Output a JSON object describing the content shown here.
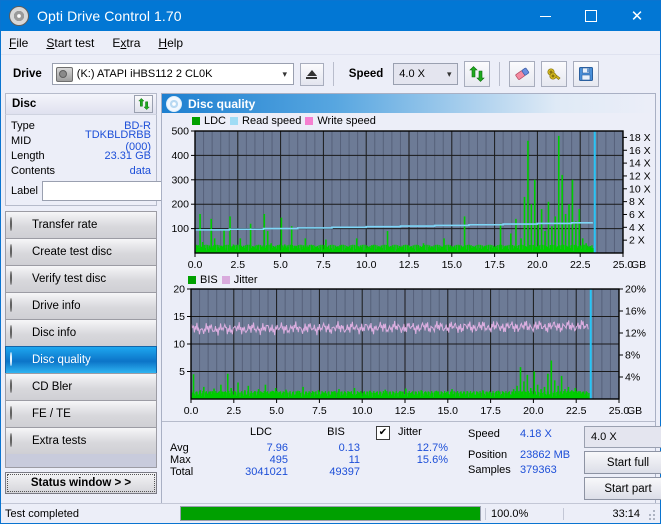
{
  "window": {
    "title": "Opti Drive Control 1.70",
    "icon": "disc-icon",
    "minimize": "–",
    "maximize": "□",
    "close": "✕"
  },
  "menubar": {
    "items": [
      {
        "label": "File",
        "accel": "F"
      },
      {
        "label": "Start test",
        "accel": "S"
      },
      {
        "label": "Extra",
        "accel": "x"
      },
      {
        "label": "Help",
        "accel": "H"
      }
    ]
  },
  "toolbar": {
    "drive_label": "Drive",
    "drive_value": "(K:)  ATAPI iHBS112  2 CL0K",
    "eject_title": "eject-button",
    "speed_label": "Speed",
    "speed_value": "4.0 X",
    "refresh_icon": "refresh-icon",
    "eraser_icon": "eraser-icon",
    "keys_icon": "keys-icon",
    "save_icon": "save-icon"
  },
  "sidebar": {
    "disc_panel": {
      "title": "Disc",
      "refresh_icon": "refresh-icon",
      "rows": [
        {
          "key": "Type",
          "value": "BD-R"
        },
        {
          "key": "MID",
          "value": "TDKBLDRBB (000)"
        },
        {
          "key": "Length",
          "value": "23.31 GB"
        },
        {
          "key": "Contents",
          "value": "data"
        }
      ],
      "label_key": "Label",
      "label_value": "",
      "label_placeholder": "",
      "label_button_icon": "cd-icon"
    },
    "nav": [
      {
        "label": "Transfer rate",
        "active": false
      },
      {
        "label": "Create test disc",
        "active": false
      },
      {
        "label": "Verify test disc",
        "active": false
      },
      {
        "label": "Drive info",
        "active": false
      },
      {
        "label": "Disc info",
        "active": false
      },
      {
        "label": "Disc quality",
        "active": true
      },
      {
        "label": "CD Bler",
        "active": false
      },
      {
        "label": "FE / TE",
        "active": false
      },
      {
        "label": "Extra tests",
        "active": false
      }
    ],
    "status_window_button": "Status window > >"
  },
  "main": {
    "header_title": "Disc quality",
    "header_icon": "disc-quality-icon"
  },
  "stats": {
    "col_headers": [
      "",
      "LDC",
      "BIS",
      "",
      "Jitter"
    ],
    "jitter_checked": true,
    "jitter_check_glyph": "✔",
    "rows": [
      {
        "key": "Avg",
        "ldc": "7.96",
        "bis": "0.13",
        "jitter": "12.7%"
      },
      {
        "key": "Max",
        "ldc": "495",
        "bis": "11",
        "jitter": "15.6%"
      },
      {
        "key": "Total",
        "ldc": "3041021",
        "bis": "49397",
        "jitter": ""
      }
    ]
  },
  "test_panel": {
    "speed_key": "Speed",
    "speed_value": "4.18 X",
    "position_key": "Position",
    "position_value": "23862 MB",
    "samples_key": "Samples",
    "samples_value": "379363",
    "speed_select": "4.0 X",
    "start_full": "Start full",
    "start_part": "Start part"
  },
  "statusbar": {
    "text": "Test completed",
    "percent": "100.0%",
    "progress": 100,
    "time": "33:14",
    "progress_color": "#00a000"
  },
  "chart_data": [
    {
      "type": "line",
      "name": "ldc-chart",
      "title": "",
      "xlabel": "GB",
      "ylabel": "",
      "x_ticks": [
        "0.0",
        "2.5",
        "5.0",
        "7.5",
        "10.0",
        "12.5",
        "15.0",
        "17.5",
        "20.0",
        "22.5",
        "25.0"
      ],
      "xlim": [
        0,
        25
      ],
      "y_left_ticks": [
        "100",
        "200",
        "300",
        "400",
        "500"
      ],
      "ylim": [
        0,
        500
      ],
      "y_right_ticks": [
        "2 X",
        "4 X",
        "6 X",
        "8 X",
        "10 X",
        "12 X",
        "14 X",
        "16 X",
        "18 X"
      ],
      "y_right_lim": [
        0,
        19
      ],
      "grid": true,
      "legend": [
        {
          "label": "LDC",
          "color": "#00a000"
        },
        {
          "label": "Read speed",
          "color": "#9fdcf5"
        },
        {
          "label": "Write speed",
          "color": "#f57fd0"
        }
      ],
      "series": [
        {
          "name": "LDC",
          "type": "impulse",
          "color": "#00cc00",
          "x": [
            0.1,
            0.25,
            0.4,
            0.55,
            0.7,
            0.9,
            1.1,
            1.3,
            1.5,
            1.65,
            1.8,
            2.0,
            2.2,
            2.4,
            2.6,
            2.8,
            3.0,
            3.2,
            3.4,
            3.6,
            3.8,
            4.0,
            4.2,
            4.4,
            4.6,
            4.8,
            5.0,
            5.2,
            5.4,
            5.6,
            5.8,
            6.0,
            6.2,
            6.4,
            6.6,
            6.8,
            7.0,
            7.3,
            7.6,
            7.9,
            8.2,
            8.5,
            8.8,
            9.1,
            9.4,
            9.7,
            10.0,
            10.3,
            10.6,
            10.9,
            11.2,
            11.5,
            11.8,
            12.1,
            12.4,
            12.7,
            13.0,
            13.3,
            13.6,
            13.9,
            14.2,
            14.5,
            14.8,
            15.1,
            15.4,
            15.7,
            16.0,
            16.3,
            16.6,
            16.9,
            17.2,
            17.5,
            17.8,
            18.1,
            18.4,
            18.7,
            19.0,
            19.2,
            19.4,
            19.6,
            19.8,
            20.0,
            20.2,
            20.4,
            20.6,
            20.8,
            21.0,
            21.2,
            21.4,
            21.6,
            21.8,
            22.0,
            22.2,
            22.4,
            22.6,
            22.8,
            23.0,
            23.2
          ],
          "y": [
            30,
            160,
            45,
            20,
            25,
            140,
            60,
            25,
            30,
            95,
            20,
            150,
            35,
            25,
            60,
            30,
            25,
            120,
            20,
            30,
            25,
            160,
            90,
            40,
            25,
            30,
            145,
            35,
            25,
            110,
            30,
            20,
            25,
            60,
            25,
            30,
            20,
            25,
            55,
            20,
            25,
            30,
            20,
            25,
            60,
            25,
            20,
            30,
            25,
            20,
            90,
            25,
            20,
            25,
            30,
            20,
            25,
            40,
            25,
            20,
            25,
            60,
            25,
            20,
            30,
            150,
            30,
            25,
            20,
            30,
            25,
            20,
            120,
            30,
            80,
            140,
            60,
            230,
            460,
            200,
            300,
            120,
            180,
            90,
            210,
            110,
            150,
            480,
            320,
            160,
            200,
            300,
            130,
            180,
            60,
            40,
            25,
            20
          ]
        },
        {
          "name": "Read speed",
          "type": "step",
          "color": "#7fd6f7",
          "x": [
            0.0,
            2.0,
            4.0,
            6.0,
            8.0,
            10.0,
            12.0,
            14.0,
            16.0,
            18.0,
            20.0,
            22.0,
            23.2
          ],
          "y": [
            3.6,
            3.7,
            3.8,
            3.9,
            4.0,
            4.1,
            4.2,
            4.3,
            4.4,
            4.5,
            4.6,
            4.7,
            4.8
          ],
          "unit": "X"
        },
        {
          "name": "end-marker",
          "type": "vline",
          "color": "#29c4f5",
          "x": 23.35
        }
      ]
    },
    {
      "type": "line",
      "name": "bis-jitter-chart",
      "title": "",
      "xlabel": "GB",
      "ylabel": "",
      "x_ticks": [
        "0.0",
        "2.5",
        "5.0",
        "7.5",
        "10.0",
        "12.5",
        "15.0",
        "17.5",
        "20.0",
        "22.5",
        "25.0"
      ],
      "xlim": [
        0,
        25
      ],
      "y_left_ticks": [
        "5",
        "10",
        "15",
        "20"
      ],
      "ylim": [
        0,
        20
      ],
      "y_right_ticks": [
        "4%",
        "8%",
        "12%",
        "16%",
        "20%"
      ],
      "y_right_lim": [
        0,
        20
      ],
      "grid": true,
      "legend": [
        {
          "label": "BIS",
          "color": "#00a000"
        },
        {
          "label": "Jitter",
          "color": "#d9aadd"
        }
      ],
      "series": [
        {
          "name": "BIS",
          "type": "impulse",
          "color": "#00cc00",
          "x": [
            0.1,
            0.3,
            0.5,
            0.7,
            0.9,
            1.1,
            1.3,
            1.5,
            1.7,
            1.9,
            2.1,
            2.3,
            2.5,
            2.7,
            2.9,
            3.1,
            3.3,
            3.5,
            3.7,
            3.9,
            4.1,
            4.3,
            4.5,
            4.7,
            4.9,
            5.1,
            5.3,
            5.5,
            5.7,
            5.9,
            6.2,
            6.5,
            6.8,
            7.1,
            7.4,
            7.7,
            8.0,
            8.3,
            8.6,
            8.9,
            9.2,
            9.5,
            9.8,
            10.1,
            10.4,
            10.7,
            11.0,
            11.3,
            11.6,
            11.9,
            12.2,
            12.5,
            12.8,
            13.1,
            13.4,
            13.7,
            14.0,
            14.3,
            14.6,
            14.9,
            15.2,
            15.5,
            15.8,
            16.1,
            16.4,
            16.7,
            17.0,
            17.3,
            17.6,
            17.9,
            18.2,
            18.5,
            18.8,
            19.0,
            19.2,
            19.4,
            19.6,
            19.8,
            20.0,
            20.2,
            20.4,
            20.6,
            20.8,
            21.0,
            21.2,
            21.4,
            21.6,
            21.8,
            22.0,
            22.2,
            22.4,
            22.6,
            22.8,
            23.0,
            23.2
          ],
          "y": [
            4.5,
            1.2,
            1.6,
            2.2,
            1.0,
            1.4,
            1.9,
            1.1,
            2.6,
            1.3,
            4.6,
            2.0,
            1.5,
            3.0,
            1.2,
            1.6,
            2.4,
            1.1,
            1.4,
            1.8,
            1.2,
            2.6,
            1.0,
            1.5,
            2.0,
            1.3,
            1.1,
            1.7,
            1.2,
            1.0,
            1.5,
            2.2,
            1.1,
            1.3,
            1.6,
            1.2,
            1.0,
            1.4,
            1.8,
            1.1,
            1.3,
            2.0,
            1.2,
            1.0,
            1.5,
            1.1,
            1.3,
            1.7,
            1.2,
            1.0,
            1.4,
            1.9,
            1.1,
            1.3,
            1.6,
            1.2,
            1.0,
            1.5,
            1.1,
            1.3,
            1.8,
            1.2,
            1.0,
            1.4,
            1.1,
            1.3,
            1.6,
            1.2,
            1.0,
            1.5,
            1.3,
            1.2,
            1.8,
            2.4,
            5.8,
            3.2,
            4.4,
            2.0,
            5.0,
            2.6,
            1.8,
            2.2,
            4.6,
            7.0,
            3.4,
            2.4,
            4.2,
            1.8,
            2.2,
            1.6,
            2.0,
            1.4,
            1.2,
            1.0,
            1.1
          ]
        },
        {
          "name": "Jitter",
          "type": "line",
          "color": "#dcaee0",
          "avg": 12.7,
          "max": 15.6,
          "unit": "%"
        },
        {
          "name": "end-marker",
          "type": "vline",
          "color": "#29c4f5",
          "x": 23.35
        }
      ]
    }
  ]
}
